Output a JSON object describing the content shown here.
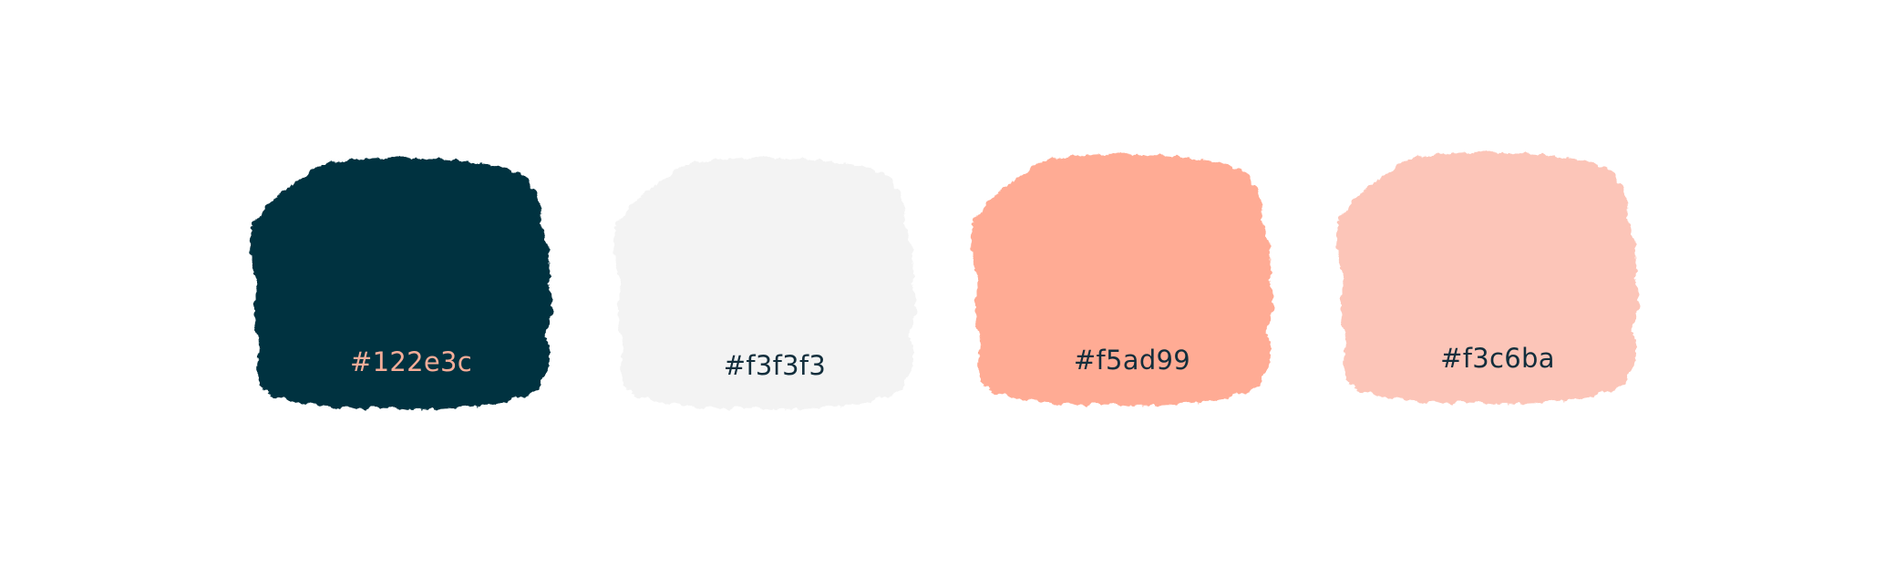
{
  "swatches": [
    {
      "label": "#122e3c",
      "fill": "#06303f",
      "label_color": "#f5ad99"
    },
    {
      "label": "#f3f3f3",
      "fill": "#f3f3f3",
      "label_color": "#122e3c"
    },
    {
      "label": "#f5ad99",
      "fill": "#ffab94",
      "label_color": "#122e3c"
    },
    {
      "label": "#f3c6ba",
      "fill": "#fcc5b8",
      "label_color": "#122e3c"
    }
  ]
}
